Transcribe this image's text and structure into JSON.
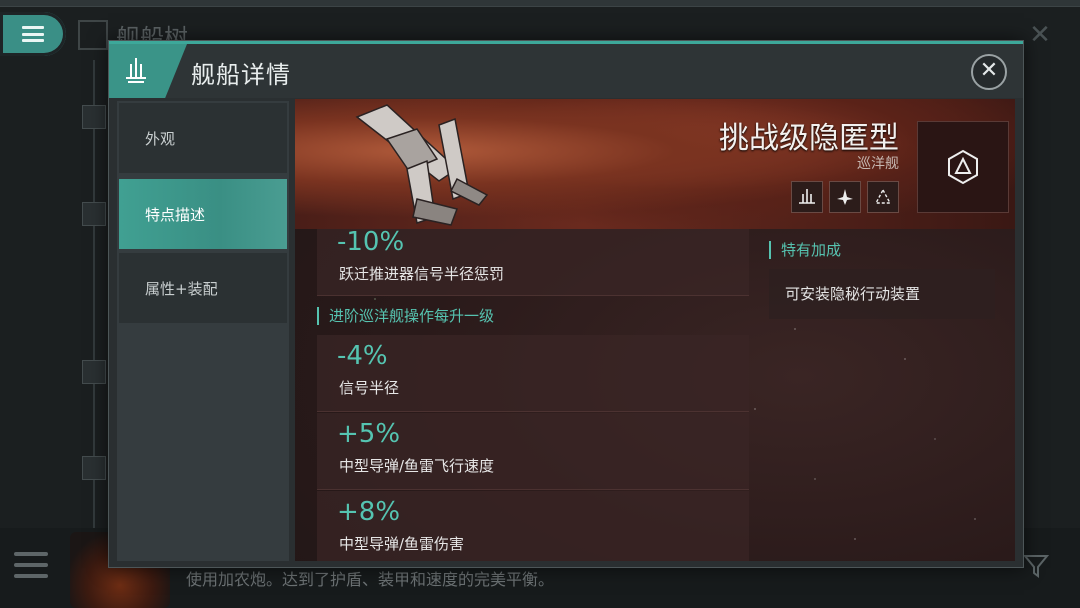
{
  "background": {
    "title": "舰船树",
    "bottom_text": "使用加农炮。达到了护盾、装甲和速度的完美平衡。"
  },
  "modal": {
    "title": "舰船详情",
    "tabs": [
      {
        "label": "外观"
      },
      {
        "label": "特点描述"
      },
      {
        "label": "属性+装配"
      }
    ],
    "active_tab": "特点描述"
  },
  "ship": {
    "name": "挑战级隐匿型",
    "class": "巡洋舰",
    "role_icons": [
      "role-icon-1",
      "role-icon-2",
      "role-icon-3"
    ]
  },
  "bonuses": {
    "top": {
      "value": "-10%",
      "desc": "跃迁推进器信号半径惩罚"
    },
    "section_title": "进阶巡洋舰操作每升一级",
    "items": [
      {
        "value": "-4%",
        "desc": "信号半径"
      },
      {
        "value": "+5%",
        "desc": "中型导弹/鱼雷飞行速度"
      },
      {
        "value": "+8%",
        "desc": "中型导弹/鱼雷伤害"
      }
    ]
  },
  "special": {
    "title": "特有加成",
    "items": [
      {
        "text": "可安装隐秘行动装置"
      }
    ]
  },
  "colors": {
    "accent": "#3da89a",
    "bonus_value": "#55c4b1"
  }
}
